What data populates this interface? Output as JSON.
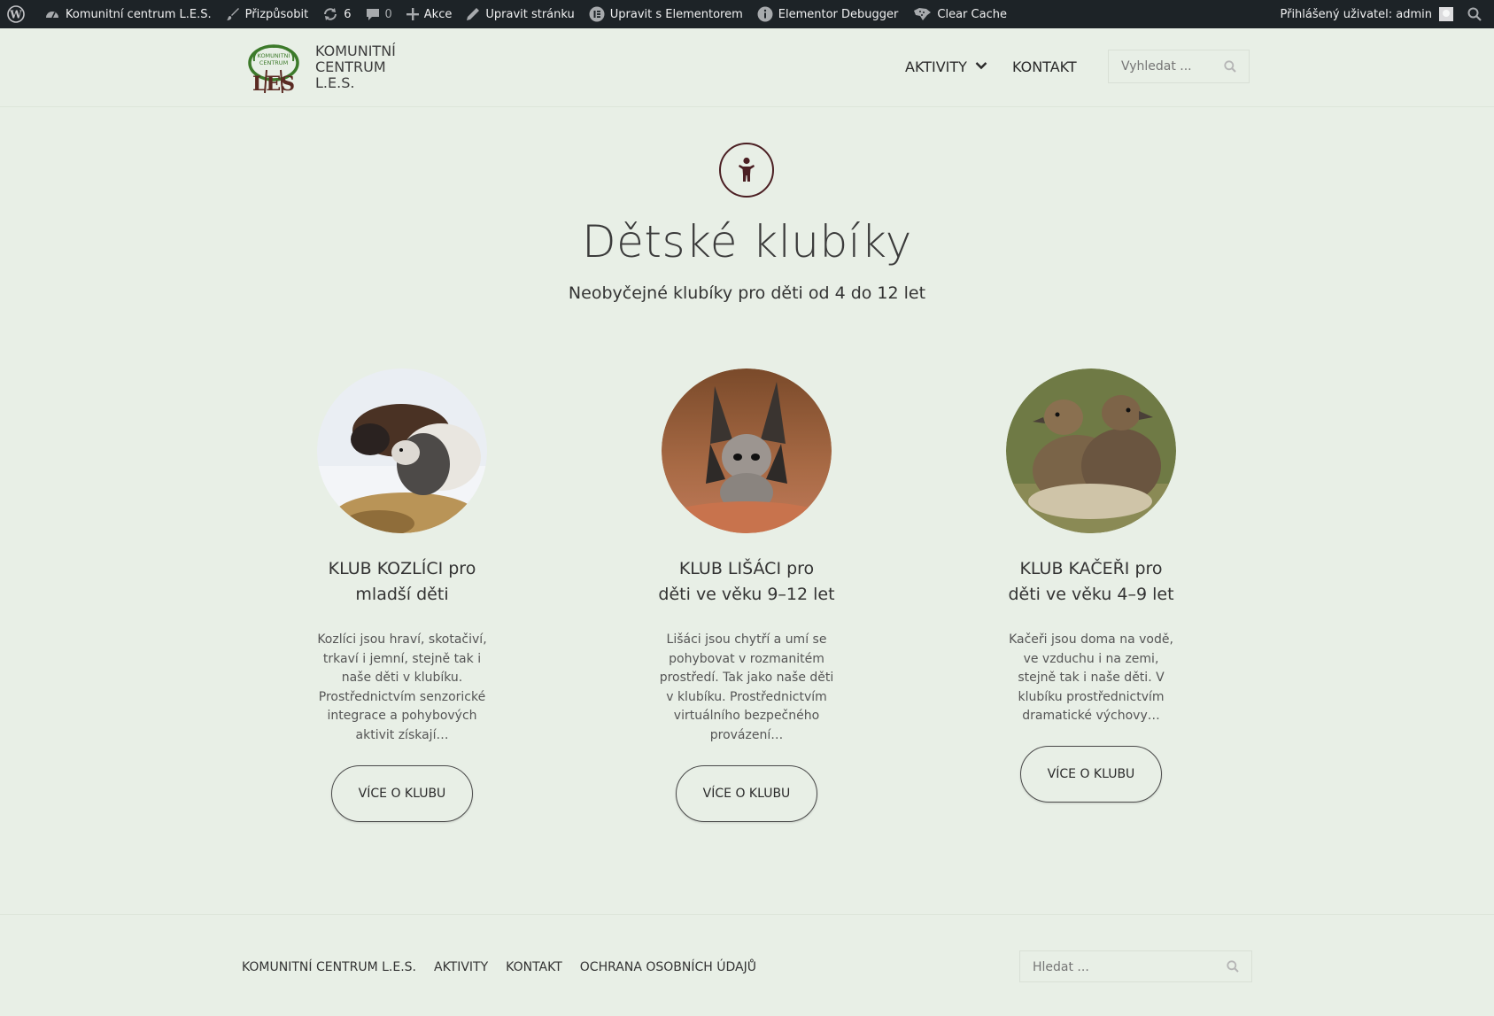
{
  "admin_bar": {
    "site_name": "Komunitní centrum L.E.S.",
    "customize": "Přizpůsobit",
    "updates_count": "6",
    "comments_count": "0",
    "new": "Akce",
    "edit_page": "Upravit stránku",
    "edit_elementor": "Upravit s Elementorem",
    "debugger": "Elementor Debugger",
    "clear_cache": "Clear Cache",
    "user": "Přihlášený uživatel: admin"
  },
  "header": {
    "site_title_lines": [
      "KOMUNITNÍ",
      "CENTRUM",
      "L.E.S."
    ],
    "nav": {
      "aktivity": "AKTIVITY",
      "kontakt": "KONTAKT"
    },
    "search_placeholder": "Vyhledat ..."
  },
  "hero": {
    "title": "Dětské klubíky",
    "subtitle": "Neobyčejné klubíky pro děti od 4 do 12 let"
  },
  "cards": [
    {
      "title_line1": "KLUB KOZLÍCI pro",
      "title_line2": "mladší děti",
      "text": "Kozlíci jsou hraví, skotačiví, trkaví i jemní, stejně tak i naše děti v klubíku. Prostřednictvím senzorické integrace a pohybových aktivit získají…",
      "button": "VÍCE O KLUBU",
      "image": "goats-in-snow"
    },
    {
      "title_line1": "KLUB LIŠÁCI pro",
      "title_line2": "děti ve věku 9–12 let",
      "text": "Lišáci jsou chytří a umí se pohybovat v rozmanitém prostředí. Tak jako naše děti v klubíku. Prostřednictvím virtuálního bezpečného provázení…",
      "button": "VÍCE O KLUBU",
      "image": "bat-eared-foxes"
    },
    {
      "title_line1": "KLUB KAČEŘI pro",
      "title_line2": "děti ve věku 4–9 let",
      "text": "Kačeři jsou doma na vodě, ve vzduchu i na zemi, stejně tak i naše děti. V klubíku prostřednictvím dramatické výchovy…",
      "button": "VÍCE O KLUBU",
      "image": "ducklings"
    }
  ],
  "footer": {
    "links": [
      "KOMUNITNÍ CENTRUM L.E.S.",
      "AKTIVITY",
      "KONTAKT",
      "OCHRANA OSOBNÍCH ÚDAJŮ"
    ],
    "search_placeholder": "Hledat ..."
  },
  "colors": {
    "page_bg": "#e8efe6",
    "admin_bar": "#1d2327",
    "accent_maroon": "#4b1f23",
    "logo_green": "#3c7a2a"
  }
}
